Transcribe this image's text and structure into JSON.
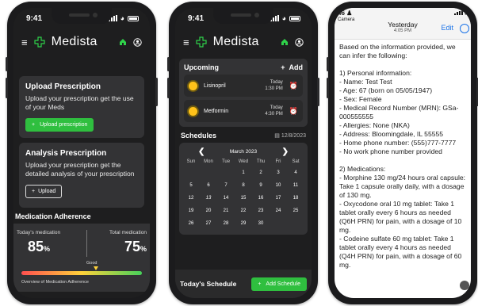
{
  "phone1": {
    "status_time": "9:41",
    "brand": "Medista",
    "upload_card": {
      "title": "Upload Prescription",
      "body": "Upload your prescription get the use of your Meds",
      "button": "Upload prescription"
    },
    "analysis_card": {
      "title": "Analysis Prescription",
      "body": "Upload your prescription get the detailed analysis of your prescription",
      "button": "Upload"
    },
    "adherence": {
      "title": "Medication Adherence",
      "today_label": "Today's medication",
      "today_value": "85",
      "total_label": "Total medication",
      "total_value": "75",
      "percent_sign": "%",
      "gauge_label": "Good",
      "gauge_level": 0.62,
      "footer": "Overview of Medication Adherence"
    },
    "colors": {
      "accent": "#2fbf3f",
      "card": "#333335"
    }
  },
  "phone2": {
    "status_time": "9:41",
    "brand": "Medista",
    "upcoming": {
      "title": "Upcoming",
      "add_label": "Add",
      "meds": [
        {
          "name": "Lisinopril",
          "day": "Today",
          "time": "1:30 PM"
        },
        {
          "name": "Metformin",
          "day": "Today",
          "time": "4:30 PM"
        }
      ]
    },
    "schedules": {
      "title": "Schedules",
      "date": "12/8/2023",
      "month": "March 2023",
      "weekdays": [
        "Sun",
        "Mon",
        "Tue",
        "Wed",
        "Thu",
        "Fri",
        "Sat"
      ],
      "weeks": [
        [
          "",
          "",
          "",
          "1",
          "2",
          "3",
          "4"
        ],
        [
          "5",
          "6",
          "7",
          "8",
          "9",
          "10",
          "11"
        ],
        [
          "12",
          "13",
          "14",
          "15",
          "16",
          "17",
          "18"
        ],
        [
          "19",
          "20",
          "21",
          "22",
          "23",
          "24",
          "25"
        ],
        [
          "26",
          "27",
          "28",
          "29",
          "30",
          "",
          ""
        ]
      ],
      "selected_day": "13"
    },
    "todays_schedule": "Today's Schedule",
    "add_schedule": "Add Schedule"
  },
  "phone3": {
    "status_time": "46",
    "back_label": "Camera",
    "header_title": "Yesterday",
    "header_time": "4:05 PM",
    "edit_label": "Edit",
    "lines": [
      "Based on the information provided, we can infer the following:",
      "",
      "1) Personal information:",
      "- Name: Test Test",
      "- Age: 67 (born on 05/05/1947)",
      "- Sex: Female",
      "- Medical Record Number (MRN): GSa-000555555",
      "- Allergies: None (NKA)",
      "- Address: Bloomingdale, IL 55555",
      "- Home phone number: (555)777-7777",
      "- No work phone number provided",
      "",
      "2) Medications:",
      "- Morphine 130 mg/24 hours oral capsule: Take 1 capsule orally daily, with a dosage of 130 mg.",
      "- Oxycodone oral 10 mg tablet: Take 1 tablet orally every 6 hours as needed (Q6H PRN) for pain, with a dosage of 10 mg.",
      "- Codeine sulfate 60 mg tablet: Take 1 tablet orally every 4 hours as needed (Q4H PRN) for pain, with a dosage of 60 mg."
    ]
  }
}
